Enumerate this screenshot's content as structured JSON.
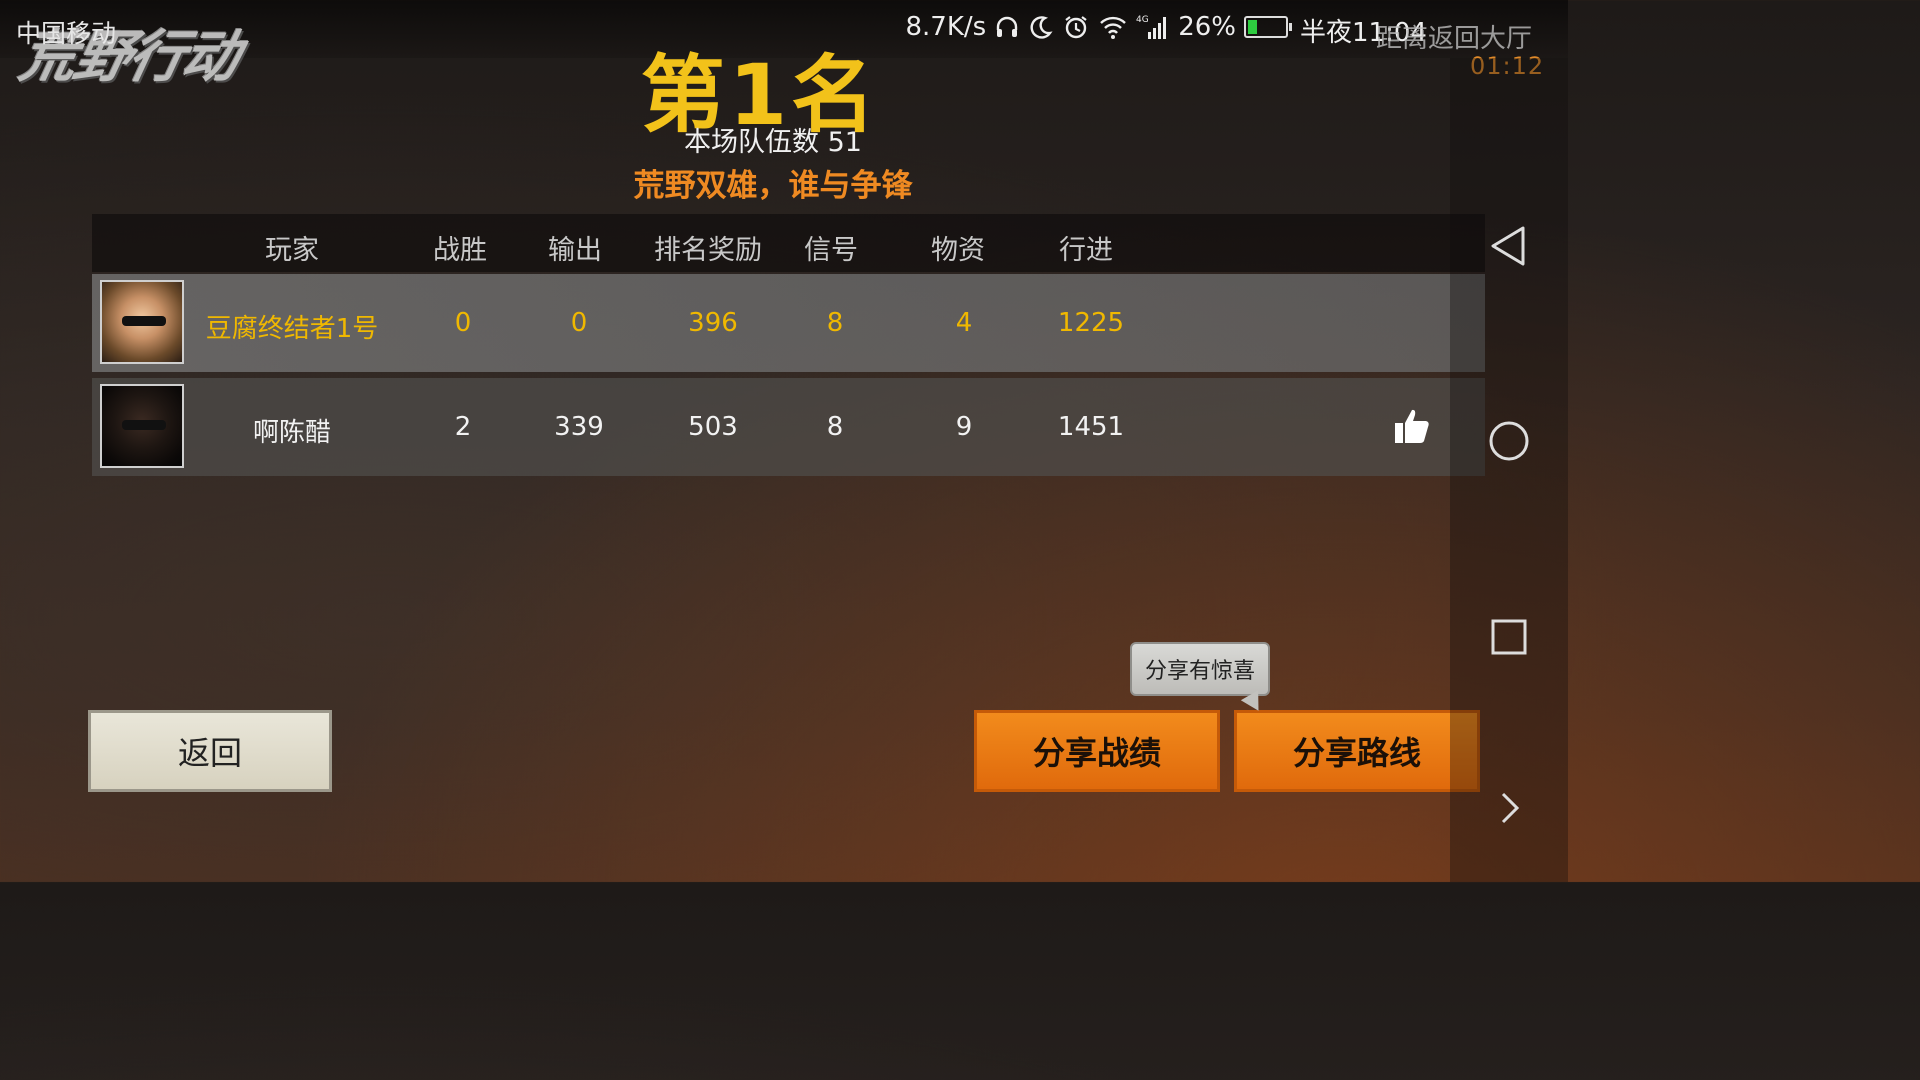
{
  "status_bar": {
    "carrier": "中国移动",
    "game_logo": "荒野行动",
    "net_speed": "8.7K/s",
    "signal_type": "4G",
    "battery_percent": "26%",
    "battery_level": 0.26,
    "time": "半夜11:04",
    "icons": [
      "headset-icon",
      "moon-icon",
      "alarm-icon",
      "wifi-icon",
      "cell-signal-icon",
      "battery-icon"
    ]
  },
  "overlay": {
    "return_hint": "距离返回大厅",
    "countdown": "01:12"
  },
  "result": {
    "rank": "第1名",
    "team_count": "本场队伍数 51",
    "slogan": "荒野双雄，谁与争锋"
  },
  "table": {
    "headers": [
      "玩家",
      "战胜",
      "输出",
      "排名奖励",
      "信号",
      "物资",
      "行进"
    ],
    "rows": [
      {
        "name": "豆腐终结者1号",
        "kills": "0",
        "damage": "0",
        "rank_reward": "396",
        "signal": "8",
        "supplies": "4",
        "travel": "1225",
        "highlight": true
      },
      {
        "name": "啊陈醋",
        "kills": "2",
        "damage": "339",
        "rank_reward": "503",
        "signal": "8",
        "supplies": "9",
        "travel": "1451",
        "highlight": false
      }
    ]
  },
  "buttons": {
    "back": "返回",
    "share_stats": "分享战绩",
    "share_route": "分享路线",
    "share_tooltip": "分享有惊喜"
  },
  "colors": {
    "rank_gold": "#f2c21a",
    "slogan_orange": "#ef8a22",
    "highlight_text": "#f0b800",
    "button_orange": "#f28b1c"
  }
}
